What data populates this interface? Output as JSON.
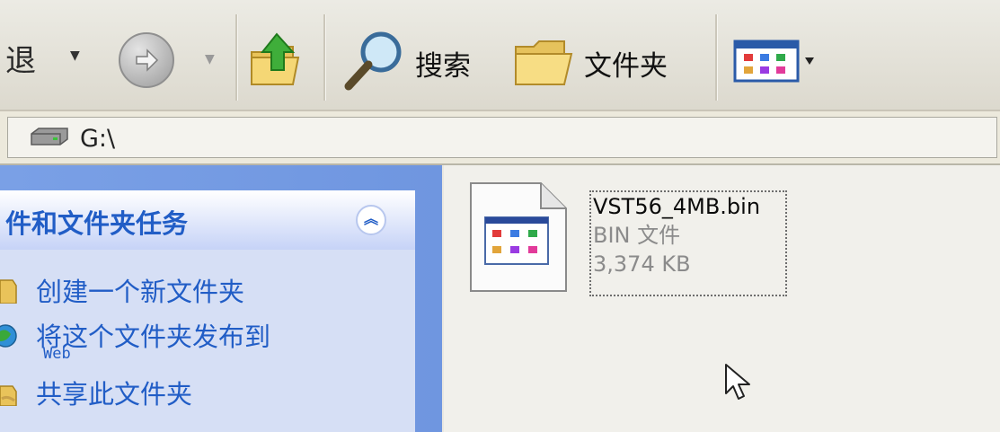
{
  "toolbar": {
    "back_label": "退",
    "search_label": "搜索",
    "folders_label": "文件夹"
  },
  "address": {
    "path": "G:\\"
  },
  "task_pane": {
    "title": "件和文件夹任务",
    "items": [
      {
        "label": "创建一个新文件夹",
        "icon": "new-folder-icon"
      },
      {
        "label": "将这个文件夹发布到",
        "sub": "Web",
        "icon": "publish-web-icon"
      },
      {
        "label": "共享此文件夹",
        "icon": "share-folder-icon"
      }
    ]
  },
  "files": [
    {
      "name": "VST56_4MB.bin",
      "type": "BIN 文件",
      "size": "3,374 KB"
    }
  ],
  "colors": {
    "task_link": "#215dc6",
    "pane_blue": "#6f96e0"
  }
}
